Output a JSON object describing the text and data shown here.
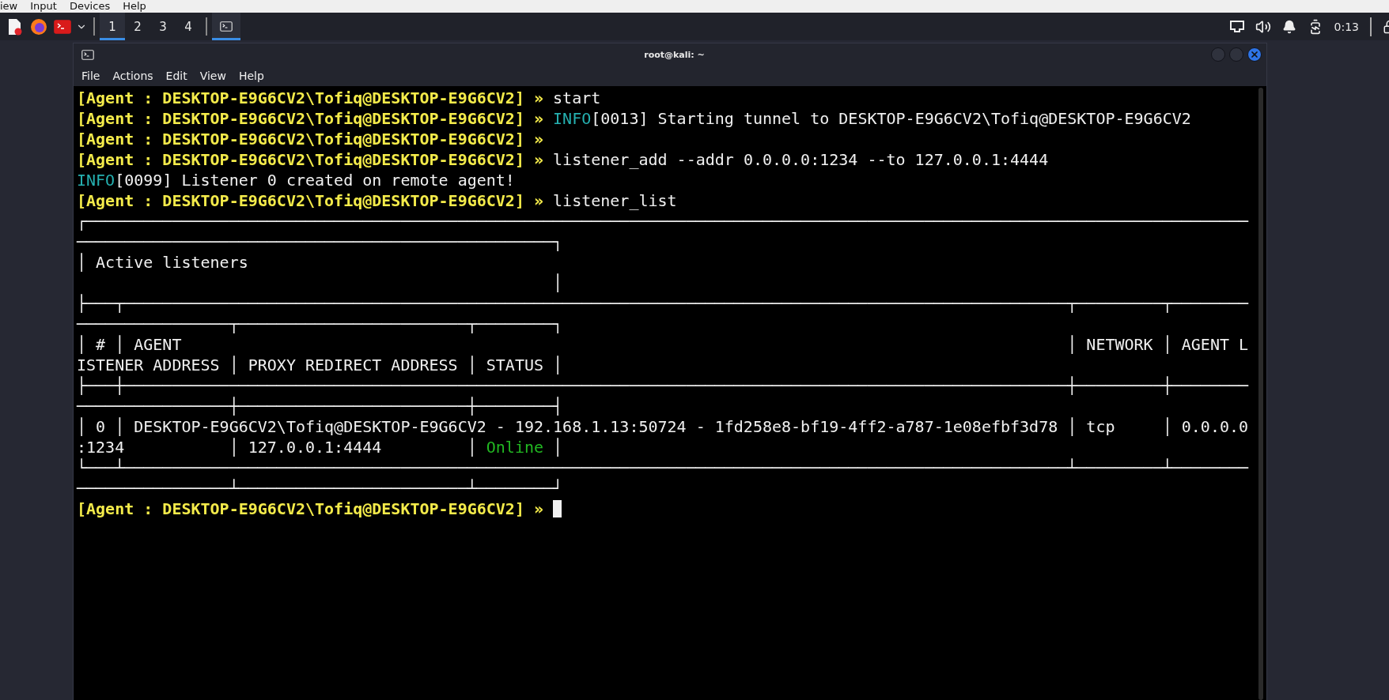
{
  "vm_menu": [
    "iew",
    "Input",
    "Devices",
    "Help"
  ],
  "taskbar": {
    "workspaces": [
      {
        "label": "1",
        "selected": true
      },
      {
        "label": "2",
        "selected": false
      },
      {
        "label": "3",
        "selected": false
      },
      {
        "label": "4",
        "selected": false
      }
    ],
    "tasks": [
      {
        "selected": true
      }
    ],
    "clock": "0:13"
  },
  "window": {
    "title": "root@kali: ~",
    "menu": [
      "File",
      "Actions",
      "Edit",
      "View",
      "Help"
    ]
  },
  "terminal": {
    "cursor": true,
    "lines": [
      [
        {
          "kind": "prompt",
          "text": "[Agent : DESKTOP-E9G6CV2\\Tofiq@DESKTOP-E9G6CV2] »"
        },
        {
          "kind": "text",
          "text": " start"
        }
      ],
      [
        {
          "kind": "prompt",
          "text": "[Agent : DESKTOP-E9G6CV2\\Tofiq@DESKTOP-E9G6CV2] » "
        },
        {
          "kind": "info",
          "text": "INFO"
        },
        {
          "kind": "text",
          "text": "[0013] Starting tunnel to DESKTOP-E9G6CV2\\Tofiq@DESKTOP-E9G6CV2"
        }
      ],
      [
        {
          "kind": "prompt",
          "text": "[Agent : DESKTOP-E9G6CV2\\Tofiq@DESKTOP-E9G6CV2] »"
        }
      ],
      [
        {
          "kind": "prompt",
          "text": "[Agent : DESKTOP-E9G6CV2\\Tofiq@DESKTOP-E9G6CV2] »"
        },
        {
          "kind": "text",
          "text": " listener_add --addr 0.0.0.0:1234 --to 127.0.0.1:4444"
        }
      ],
      [
        {
          "kind": "info",
          "text": "INFO"
        },
        {
          "kind": "text",
          "text": "[0099] Listener 0 created on remote agent!"
        }
      ],
      [
        {
          "kind": "prompt",
          "text": "[Agent : DESKTOP-E9G6CV2\\Tofiq@DESKTOP-E9G6CV2] »"
        },
        {
          "kind": "text",
          "text": " listener_list"
        }
      ],
      [
        {
          "kind": "text",
          "text": "┌──────────────────────────────────────────────────────────────────────────────────────────────────────────────────────────"
        }
      ],
      [
        {
          "kind": "text",
          "text": "──────────────────────────────────────────────────┐"
        }
      ],
      [
        {
          "kind": "text",
          "text": "│ Active listeners"
        }
      ],
      [
        {
          "kind": "text",
          "text": "                                                  │"
        }
      ],
      [
        {
          "kind": "text",
          "text": "├───┬───────────────────────────────────────────────────────────────────────────────────────────────────┬─────────┬────────"
        }
      ],
      [
        {
          "kind": "text",
          "text": "────────────────┬────────────────────────┬────────┐"
        }
      ],
      [
        {
          "kind": "text",
          "text": "│ # │ AGENT                                                                                             │ NETWORK │ AGENT L"
        }
      ],
      [
        {
          "kind": "text",
          "text": "ISTENER ADDRESS │ PROXY REDIRECT ADDRESS │ STATUS │"
        }
      ],
      [
        {
          "kind": "text",
          "text": "├───┼───────────────────────────────────────────────────────────────────────────────────────────────────┼─────────┼────────"
        }
      ],
      [
        {
          "kind": "text",
          "text": "────────────────┼────────────────────────┼────────┤"
        }
      ],
      [
        {
          "kind": "text",
          "text": "│ 0 │ DESKTOP-E9G6CV2\\Tofiq@DESKTOP-E9G6CV2 - 192.168.1.13:50724 - 1fd258e8-bf19-4ff2-a787-1e08efbf3d78 │ tcp     │ 0.0.0.0"
        }
      ],
      [
        {
          "kind": "text",
          "text": ":1234           │ 127.0.0.1:4444         │ "
        },
        {
          "kind": "ok",
          "text": "Online"
        },
        {
          "kind": "text",
          "text": " │"
        }
      ],
      [
        {
          "kind": "text",
          "text": "└───┴───────────────────────────────────────────────────────────────────────────────────────────────────┴─────────┴────────"
        }
      ],
      [
        {
          "kind": "text",
          "text": "────────────────┴────────────────────────┴────────┘"
        }
      ],
      [
        {
          "kind": "prompt",
          "text": "[Agent : DESKTOP-E9G6CV2\\Tofiq@DESKTOP-E9G6CV2] » "
        }
      ]
    ]
  }
}
